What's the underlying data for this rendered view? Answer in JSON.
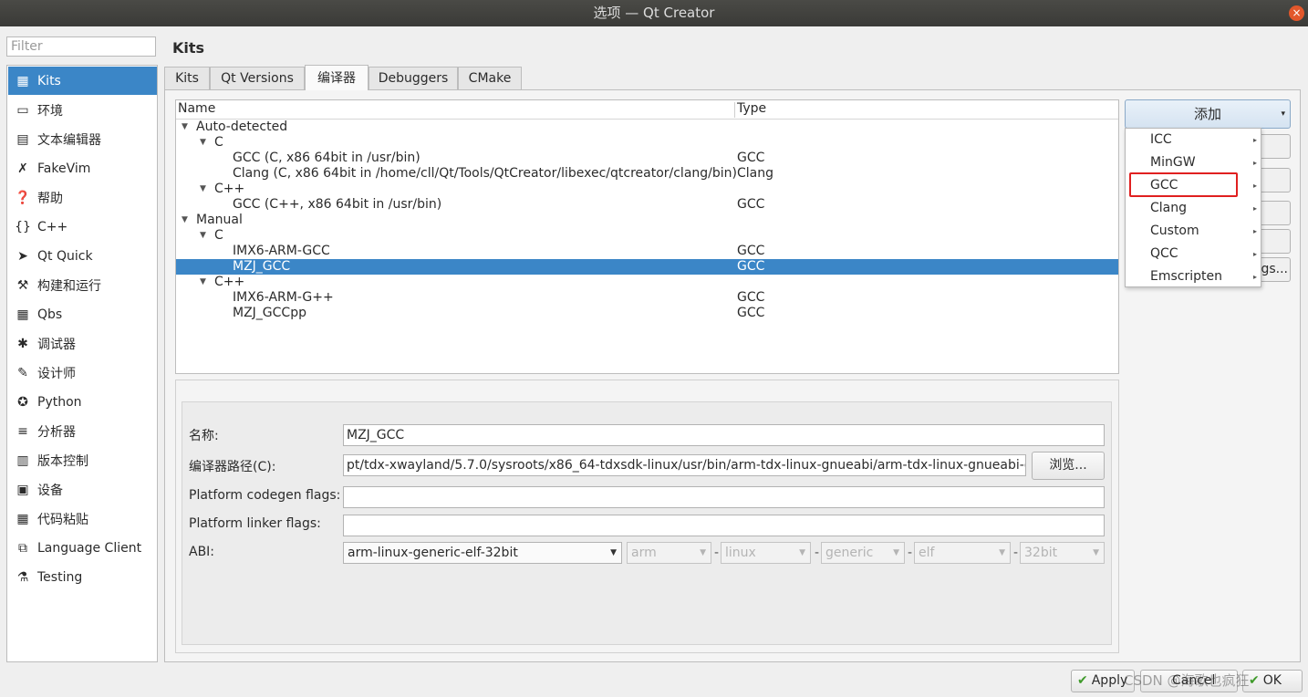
{
  "window": {
    "title": "选项 — Qt Creator",
    "close_glyph": "×"
  },
  "filter": {
    "placeholder": "Filter"
  },
  "sidebar": {
    "items": [
      {
        "label": "Kits",
        "icon": "kits-icon",
        "glyph": "▦"
      },
      {
        "label": "环境",
        "icon": "monitor-icon",
        "glyph": "▭"
      },
      {
        "label": "文本编辑器",
        "icon": "text-editor-icon",
        "glyph": "▤"
      },
      {
        "label": "FakeVim",
        "icon": "fakevim-icon",
        "glyph": "✗"
      },
      {
        "label": "帮助",
        "icon": "help-icon",
        "glyph": "❓"
      },
      {
        "label": "C++",
        "icon": "cpp-icon",
        "glyph": "{}"
      },
      {
        "label": "Qt Quick",
        "icon": "qt-quick-icon",
        "glyph": "➤"
      },
      {
        "label": "构建和运行",
        "icon": "build-run-icon",
        "glyph": "⚒"
      },
      {
        "label": "Qbs",
        "icon": "qbs-icon",
        "glyph": "▦"
      },
      {
        "label": "调试器",
        "icon": "debugger-icon",
        "glyph": "✱"
      },
      {
        "label": "设计师",
        "icon": "designer-icon",
        "glyph": "✎"
      },
      {
        "label": "Python",
        "icon": "python-icon",
        "glyph": "✪"
      },
      {
        "label": "分析器",
        "icon": "analyzer-icon",
        "glyph": "≡"
      },
      {
        "label": "版本控制",
        "icon": "version-control-icon",
        "glyph": "▥"
      },
      {
        "label": "设备",
        "icon": "devices-icon",
        "glyph": "▣"
      },
      {
        "label": "代码粘贴",
        "icon": "code-paste-icon",
        "glyph": "▦"
      },
      {
        "label": "Language Client",
        "icon": "language-client-icon",
        "glyph": "⧉"
      },
      {
        "label": "Testing",
        "icon": "testing-icon",
        "glyph": "⚗"
      }
    ]
  },
  "page": {
    "heading": "Kits"
  },
  "tabs": [
    "Kits",
    "Qt Versions",
    "编译器",
    "Debuggers",
    "CMake"
  ],
  "tree": {
    "columns": [
      "Name",
      "Type"
    ],
    "rows": [
      {
        "name": "Auto-detected",
        "type": ""
      },
      {
        "name": "C",
        "type": ""
      },
      {
        "name": "GCC (C, x86 64bit in /usr/bin)",
        "type": "GCC"
      },
      {
        "name": "Clang (C, x86 64bit in /home/cll/Qt/Tools/QtCreator/libexec/qtcreator/clang/bin)",
        "type": "Clang"
      },
      {
        "name": "C++",
        "type": ""
      },
      {
        "name": "GCC (C++, x86 64bit in /usr/bin)",
        "type": "GCC"
      },
      {
        "name": "Manual",
        "type": ""
      },
      {
        "name": "C",
        "type": ""
      },
      {
        "name": "IMX6-ARM-GCC",
        "type": "GCC"
      },
      {
        "name": "MZJ_GCC",
        "type": "GCC"
      },
      {
        "name": "C++",
        "type": ""
      },
      {
        "name": "IMX6-ARM-G++",
        "type": "GCC"
      },
      {
        "name": "MZJ_GCCpp",
        "type": "GCC"
      }
    ]
  },
  "details": {
    "name_label": "名称:",
    "name_value": "MZJ_GCC",
    "path_label": "编译器路径(C):",
    "path_value": "pt/tdx-xwayland/5.7.0/sysroots/x86_64-tdxsdk-linux/usr/bin/arm-tdx-linux-gnueabi/arm-tdx-linux-gnueabi-gcc",
    "browse_label": "浏览...",
    "codegen_label": "Platform codegen flags:",
    "codegen_value": "",
    "linker_label": "Platform linker flags:",
    "linker_value": "",
    "abi_label": "ABI:",
    "abi_value": "arm-linux-generic-elf-32bit",
    "abi_parts": [
      "arm",
      "linux",
      "generic",
      "elf",
      "32bit"
    ],
    "abi_sep": "-"
  },
  "add_button": {
    "label": "添加",
    "arrow": "▾"
  },
  "side_buttons": {
    "partial_label": "gs..."
  },
  "add_menu": {
    "items": [
      "ICC",
      "MinGW",
      "GCC",
      "Clang",
      "Custom",
      "QCC",
      "Emscripten"
    ],
    "arrow": "▸"
  },
  "footer": {
    "apply": "Apply",
    "cancel": "Cancel",
    "ok": "OK",
    "check": "✔"
  },
  "watermark": "CSDN @海歌也疯狂",
  "colors": {
    "selection": "#3b86c7",
    "highlight_box": "#e02020"
  }
}
